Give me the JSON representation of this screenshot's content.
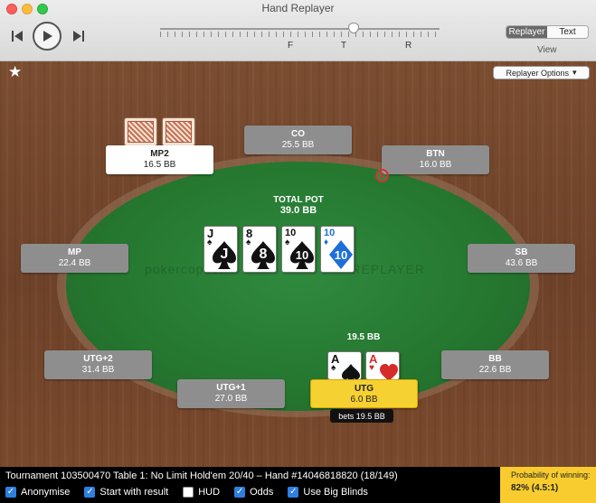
{
  "window": {
    "title": "Hand Replayer"
  },
  "controls": {
    "streets": [
      "F",
      "T",
      "R"
    ],
    "view_tabs": [
      "Replayer",
      "Text"
    ],
    "view_label": "View",
    "options_label": "Replayer Options"
  },
  "table": {
    "pot_label": "TOTAL POT",
    "pot_value": "39.0 BB",
    "bet_amount": "19.5 BB",
    "watermark_left": "pokercopilot",
    "watermark_right": "REPLAYER",
    "dealer_label": "D",
    "board": [
      {
        "rank": "J",
        "suit": "♠",
        "color": "#111111"
      },
      {
        "rank": "8",
        "suit": "♠",
        "color": "#111111"
      },
      {
        "rank": "10",
        "suit": "♠",
        "color": "#111111"
      },
      {
        "rank": "10",
        "suit": "♦",
        "color": "#1e6ed8"
      }
    ],
    "hero_cards": [
      {
        "rank": "A",
        "suit": "♠",
        "color": "#111111"
      },
      {
        "rank": "A",
        "suit": "♥",
        "color": "#d62b2b"
      }
    ]
  },
  "seats": {
    "co": {
      "name": "CO",
      "stack": "25.5 BB"
    },
    "mp2": {
      "name": "MP2",
      "stack": "16.5 BB"
    },
    "btn": {
      "name": "BTN",
      "stack": "16.0 BB"
    },
    "mp": {
      "name": "MP",
      "stack": "22.4 BB"
    },
    "sb": {
      "name": "SB",
      "stack": "43.6 BB"
    },
    "utg2": {
      "name": "UTG+2",
      "stack": "31.4 BB"
    },
    "bb": {
      "name": "BB",
      "stack": "22.6 BB"
    },
    "utg1": {
      "name": "UTG+1",
      "stack": "27.0 BB"
    },
    "utg": {
      "name": "UTG",
      "stack": "6.0 BB",
      "action": "bets 19.5 BB"
    }
  },
  "status": {
    "hand_info": "Tournament 103500470 Table 1: No Limit Hold'em 20/40 – Hand #14046818820 (18/149)",
    "checkboxes": [
      {
        "label": "Anonymise",
        "checked": true
      },
      {
        "label": "Start with result",
        "checked": true
      },
      {
        "label": "HUD",
        "checked": false
      },
      {
        "label": "Odds",
        "checked": true
      },
      {
        "label": "Use Big Blinds",
        "checked": true
      }
    ],
    "probability_label": "Probability of winning:",
    "probability_value": "82% (4.5:1)"
  },
  "colors": {
    "felt": "#2b8139",
    "active_seat": "#f6d132",
    "accent": "#2f7fe0"
  }
}
